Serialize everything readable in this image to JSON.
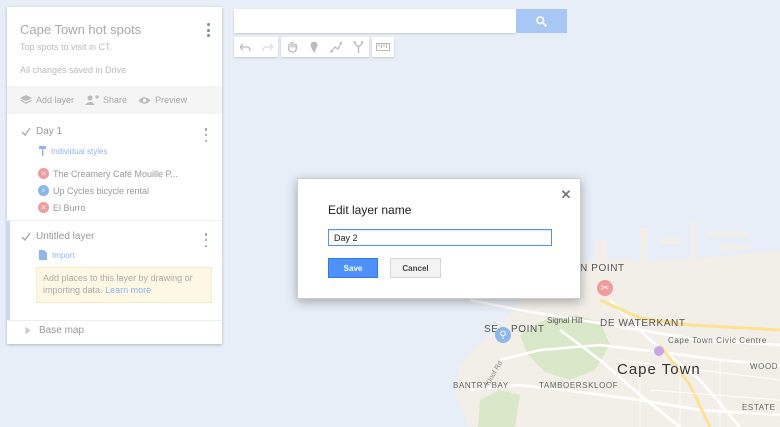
{
  "map_title": "Cape Town hot spots",
  "map_description": "Top spots to visit in CT.",
  "save_status": "All changes saved in Drive",
  "actions": {
    "add_layer": "Add layer",
    "share": "Share",
    "preview": "Preview"
  },
  "layers": [
    {
      "name": "Day 1",
      "style_link": "Individual styles",
      "places": [
        {
          "name": "The Creamery Café Mouille P...",
          "icon": "restaurant-icon",
          "color": "#f29b9b"
        },
        {
          "name": "Up Cycles bicycle rental",
          "icon": "bicycle-icon",
          "color": "#8bb8ec"
        },
        {
          "name": "El Burro",
          "icon": "restaurant-icon",
          "color": "#f29b9b"
        }
      ]
    },
    {
      "name": "Untitled layer",
      "import_link": "Import",
      "hint_text": "Add places to this layer by drawing or importing data.",
      "hint_link": "Learn more"
    }
  ],
  "base_map": "Base map",
  "search": {
    "value": "",
    "placeholder": ""
  },
  "toolbar": [
    "undo-icon",
    "redo-icon",
    "hand-icon",
    "marker-icon",
    "draw-line-icon",
    "directions-icon",
    "ruler-icon"
  ],
  "dialog": {
    "title": "Edit layer name",
    "input_value": "Day 2",
    "save_label": "Save",
    "cancel_label": "Cancel"
  },
  "map_labels": {
    "point_partial": "N POINT",
    "de_waterkant": "DE WATERKANT",
    "sea_point_left": "SE",
    "sea_point_right": "POINT",
    "signal_hill": "Signal Hill",
    "civic_centre": "Cape Town Civic Centre",
    "cape_town": "Cape Town",
    "woodstock_partial": "WOOD",
    "bantry_bay": "BANTRY BAY",
    "tamboerskloof": "TAMBOERSKLOOF",
    "estate_partial": "ESTATE",
    "kloof_road": "Kloof Rd"
  },
  "colors": {
    "accent": "#4d90fe",
    "map_water": "#e8eef8",
    "map_land": "#f2efe9",
    "pin_restaurant": "#f29b9b",
    "pin_bicycle": "#8bb8ec"
  }
}
